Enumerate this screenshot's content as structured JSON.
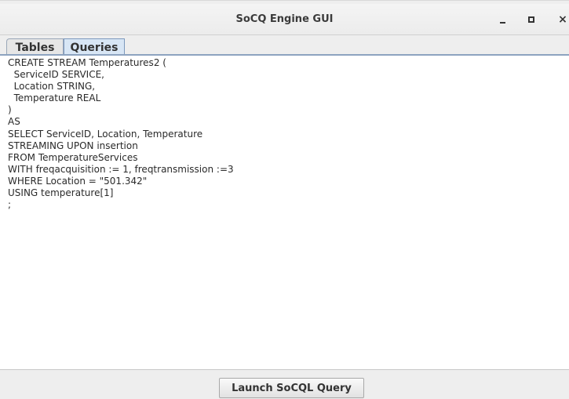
{
  "window": {
    "title": "SoCQ Engine GUI",
    "controls": {
      "minimize": "minimize-icon",
      "maximize": "maximize-icon",
      "close": "close-icon",
      "close_glyph": "×"
    }
  },
  "tabs": [
    {
      "label": "Tables",
      "selected": false
    },
    {
      "label": "Queries",
      "selected": true
    }
  ],
  "editor": {
    "text": "CREATE STREAM Temperatures2 (\n  ServiceID SERVICE,\n  Location STRING,\n  Temperature REAL\n)\nAS\nSELECT ServiceID, Location, Temperature\nSTREAMING UPON insertion\nFROM TemperatureServices\nWITH freqacquisition := 1, freqtransmission :=3\nWHERE Location = \"501.342\"\nUSING temperature[1]\n;"
  },
  "actions": {
    "launch_label": "Launch SoCQL Query"
  },
  "colors": {
    "selected_tab": "#d8e6f5",
    "tab_border": "#7c98bd",
    "window_bg": "#eeeeee"
  }
}
